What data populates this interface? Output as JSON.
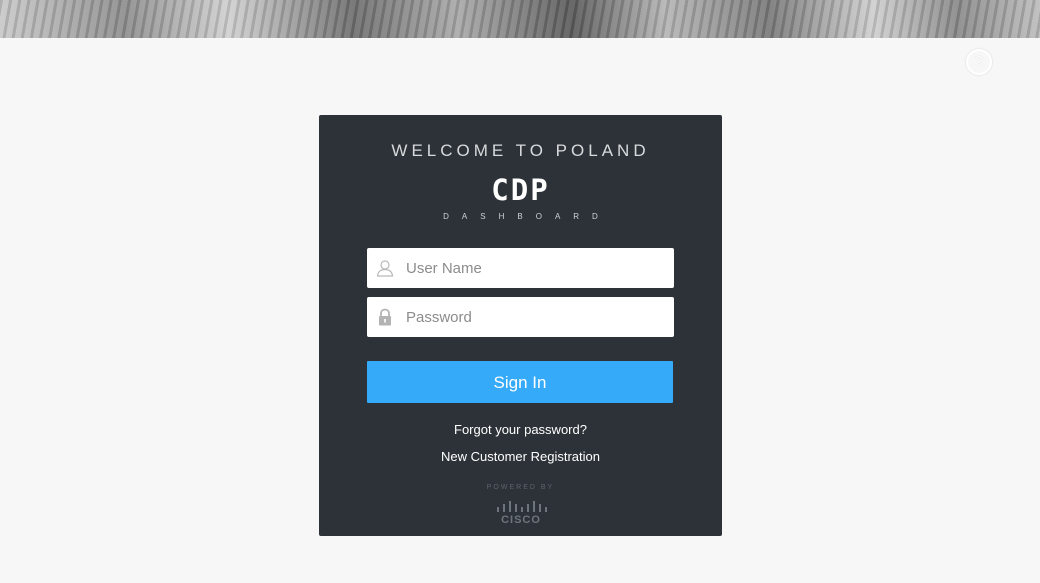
{
  "header": {
    "help_icon": "question-circle-icon",
    "help_glyph": "?"
  },
  "login": {
    "welcome": "WELCOME TO POLAND",
    "logo_text": "CDP",
    "logo_subtitle": "DASHBOARD",
    "username": {
      "placeholder": "User Name",
      "value": "",
      "icon": "user-icon"
    },
    "password": {
      "placeholder": "Password",
      "value": "",
      "icon": "lock-icon"
    },
    "sign_in_label": "Sign In",
    "forgot_password": "Forgot your password?",
    "new_registration": "New Customer Registration",
    "powered_by": "POWERED BY",
    "brand": "CISCO"
  },
  "colors": {
    "panel": "#2c3238",
    "accent": "#35aaf8",
    "page_background": "#f7f7f7"
  }
}
